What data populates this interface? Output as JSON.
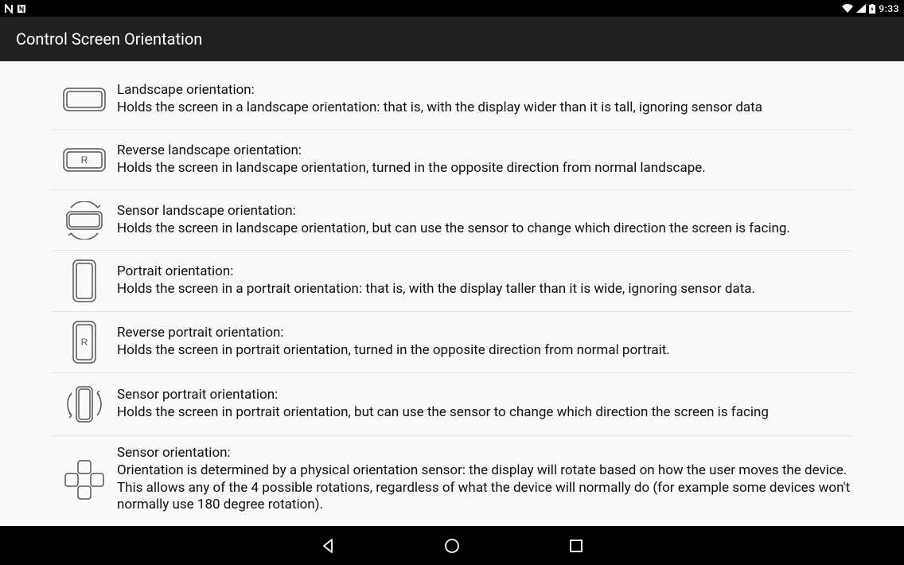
{
  "status": {
    "time": "9:33"
  },
  "appbar": {
    "title": "Control Screen Orientation"
  },
  "items": [
    {
      "title": "Landscape orientation:",
      "desc": "Holds the screen in a landscape orientation: that is, with the display wider than it is tall, ignoring sensor data"
    },
    {
      "title": "Reverse landscape orientation:",
      "desc": "Holds the screen in landscape orientation, turned in the opposite direction from normal landscape."
    },
    {
      "title": "Sensor landscape orientation:",
      "desc": "Holds the screen in landscape orientation, but can use the sensor to change which direction the screen is facing."
    },
    {
      "title": "Portrait orientation:",
      "desc": "Holds the screen in a portrait orientation: that is, with the display taller than it is wide, ignoring sensor data."
    },
    {
      "title": "Reverse portrait orientation:",
      "desc": "Holds the screen in portrait orientation, turned in the opposite direction from normal portrait."
    },
    {
      "title": "Sensor portrait orientation:",
      "desc": "Holds the screen in portrait orientation, but can use the sensor to change which direction the screen is facing"
    },
    {
      "title": "Sensor orientation:",
      "desc": "Orientation is determined by a physical orientation sensor: the display will rotate based on how the user moves the device. This allows any of the 4 possible rotations, regardless of what the device will normally do (for example some devices won't normally use 180 degree rotation)."
    }
  ]
}
